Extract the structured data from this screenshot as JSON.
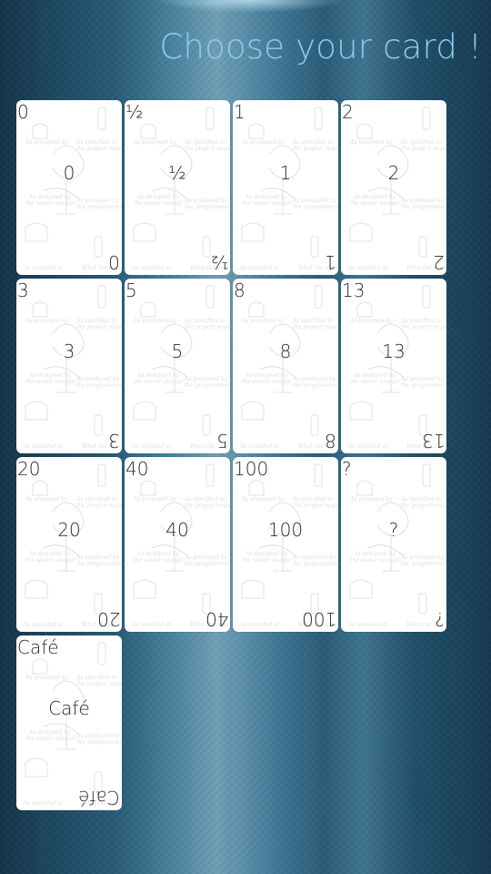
{
  "header": {
    "title": "Choose your card !"
  },
  "cards": [
    {
      "value": "0"
    },
    {
      "value": "½"
    },
    {
      "value": "1"
    },
    {
      "value": "2"
    },
    {
      "value": "3"
    },
    {
      "value": "5"
    },
    {
      "value": "8"
    },
    {
      "value": "13"
    },
    {
      "value": "20"
    },
    {
      "value": "40"
    },
    {
      "value": "100"
    },
    {
      "value": "?"
    },
    {
      "value": "Café"
    }
  ],
  "colors": {
    "title": "#8ccbf0",
    "card_background": "#ffffff",
    "card_text": "#2a2a2a"
  }
}
